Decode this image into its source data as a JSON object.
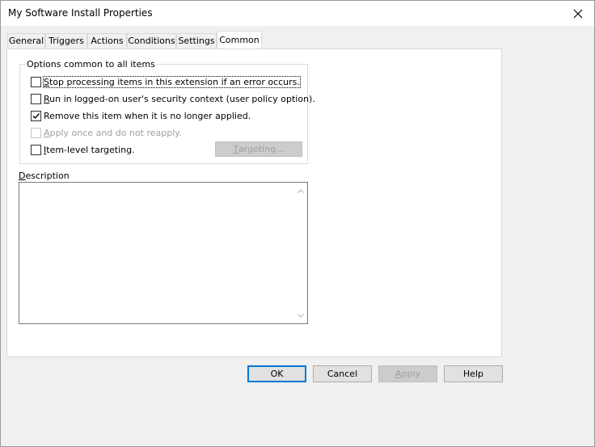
{
  "window": {
    "title": "My Software Install Properties"
  },
  "tabs": [
    {
      "label": "General"
    },
    {
      "label": "Triggers"
    },
    {
      "label": "Actions"
    },
    {
      "label": "Conditions"
    },
    {
      "label": "Settings"
    },
    {
      "label": "Common",
      "active": true
    }
  ],
  "options_group": {
    "legend": "Options common to all items",
    "options": [
      {
        "mnemonic": "S",
        "rest": "top processing items in this extension if an error occurs.",
        "checked": false,
        "enabled": true
      },
      {
        "mnemonic": "R",
        "rest": "un in logged-on user's security context (user policy option).",
        "checked": false,
        "enabled": true
      },
      {
        "mnemonic": "",
        "rest": "Remove this item when it is no longer applied.",
        "checked": true,
        "enabled": true
      },
      {
        "mnemonic": "A",
        "rest": "pply once and do not reapply.",
        "checked": false,
        "enabled": false
      },
      {
        "mnemonic": "I",
        "rest": "tem-level targeting.",
        "checked": false,
        "enabled": true
      }
    ],
    "targeting_button": {
      "mnemonic": "T",
      "rest": "argeting..."
    }
  },
  "description": {
    "mnemonic": "D",
    "rest": "escription",
    "value": ""
  },
  "footer": {
    "ok": "OK",
    "cancel": "Cancel",
    "apply_mnemonic": "A",
    "apply_rest": "pply",
    "help": "Help"
  }
}
